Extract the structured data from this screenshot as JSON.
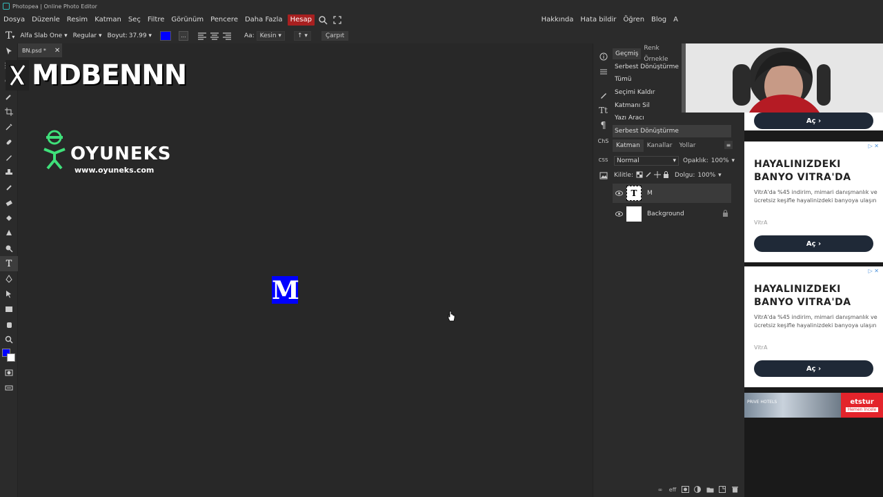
{
  "window_title": "Photopea | Online Photo Editor",
  "menu": {
    "items": [
      "Dosya",
      "Düzenle",
      "Resim",
      "Katman",
      "Seç",
      "Filtre",
      "Görünüm",
      "Pencere",
      "Daha Fazla"
    ],
    "account": "Hesap",
    "right": [
      "Hakkında",
      "Hata bildir",
      "Öğren",
      "Blog",
      "A"
    ]
  },
  "options": {
    "font": "Alfa Slab One",
    "style": "Regular",
    "size_label": "Boyut:",
    "size_value": "37.99",
    "text_color": "#0000ff",
    "more": "...",
    "aa_label": "Aa:",
    "aa_value": "Kesin",
    "orient": "↑",
    "warp": "Çarpıt"
  },
  "document": {
    "tab": "BN.psd *",
    "letter": "M"
  },
  "overlay": {
    "x_handle": "MDBENNN",
    "brand": "OYUNEKS",
    "brand_url": "www.oyuneks.com"
  },
  "history": {
    "tabs": [
      "Geçmiş",
      "Renk Örnekle"
    ],
    "items": [
      "Serbest Dönüştürme",
      "Tümü",
      "Seçimi Kaldır",
      "Katmanı Sil",
      "Yazı Aracı",
      "Serbest Dönüştürme"
    ]
  },
  "side_icons": {
    "text": "Tt",
    "para": "¶",
    "chs": "ChS",
    "css": "CSS"
  },
  "layers": {
    "tabs": [
      "Katman",
      "Kanallar",
      "Yollar"
    ],
    "blend": "Normal",
    "opacity_label": "Opaklık:",
    "opacity": "100%",
    "lock_label": "Kilitle:",
    "fill_label": "Dolgu:",
    "fill": "100%",
    "rows": [
      {
        "name": "M",
        "thumb": "T"
      },
      {
        "name": "Background",
        "thumb": ""
      }
    ],
    "footer_fx": "eff"
  },
  "ads": {
    "top_button": "Aç",
    "cards": [
      {
        "title_line1": "HAYALINIZDEKI",
        "title_line2": "BANYO VITRA'DA",
        "body": "VitrA'da %45 indirim, mimari danışmanlık ve ücretsiz keşifle hayalinizdeki banyoya ulaşın",
        "brand": "VitrA",
        "button": "Aç"
      },
      {
        "title_line1": "HAYALINIZDEKI",
        "title_line2": "BANYO VITRA'DA",
        "body": "VitrA'da %45 indirim, mimari danışmanlık ve ücretsiz keşifle hayalinizdeki banyoya ulaşın",
        "brand": "VitrA",
        "button": "Aç"
      }
    ],
    "banner_left": "PRIVE HOTELS",
    "banner_brand": "etstur",
    "banner_cta": "Hemen İncele"
  },
  "colors": {
    "accent_red": "#a82020",
    "foreground": "#0000ff",
    "background": "#ffffff"
  }
}
